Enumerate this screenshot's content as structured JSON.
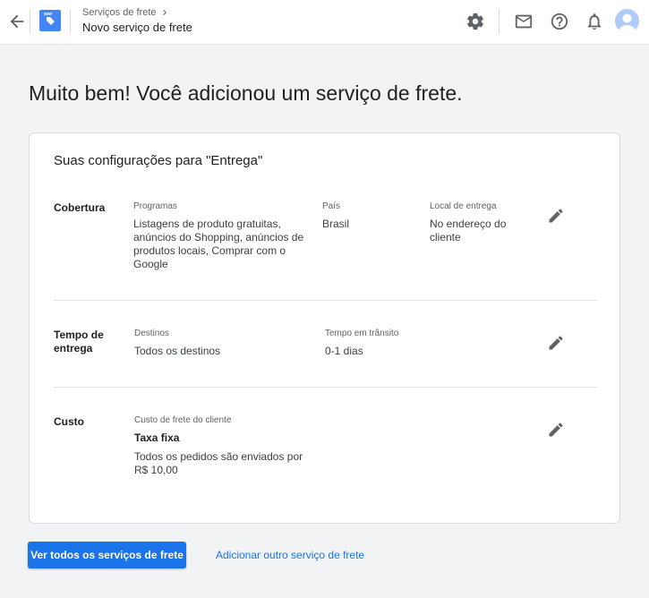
{
  "header": {
    "breadcrumb": "Serviços de frete",
    "title": "Novo serviço de frete"
  },
  "heading": "Muito bem! Você adicionou um serviço de frete.",
  "card": {
    "title": "Suas configurações para \"Entrega\"",
    "coverage": {
      "label": "Cobertura",
      "programs_label": "Programas",
      "programs_lines": [
        "Listagens de produto gratuitas,",
        "anúncios do Shopping, anúncios de",
        "produtos locais, Comprar com o",
        "Google"
      ],
      "country_label": "País",
      "country_value": "Brasil",
      "delivery_location_label": "Local de entrega",
      "delivery_location_lines": [
        "No endereço do",
        "cliente"
      ]
    },
    "delivery_time": {
      "label_lines": [
        "Tempo de",
        "entrega"
      ],
      "destinations_label": "Destinos",
      "destinations_value": "Todos os destinos",
      "transit_label": "Tempo em trânsito",
      "transit_value": "0-1 dias"
    },
    "cost": {
      "label": "Custo",
      "customer_cost_label": "Custo de frete do cliente",
      "rate_type": "Taxa fixa",
      "description_lines": [
        "Todos os pedidos são enviados por",
        "R$ 10,00"
      ]
    }
  },
  "actions": {
    "view_all": "Ver todos os serviços de frete",
    "add_another": "Adicionar outro serviço de frete"
  },
  "icons": {
    "back": "arrow-back-icon",
    "logo": "merchant-center-logo",
    "settings": "gear-icon",
    "mail": "mail-icon",
    "help": "help-icon",
    "notifications": "bell-icon",
    "edit": "pencil-icon"
  },
  "colors": {
    "primary": "#1a73e8",
    "logo": "#4285f4",
    "background": "#f1f3f4"
  }
}
